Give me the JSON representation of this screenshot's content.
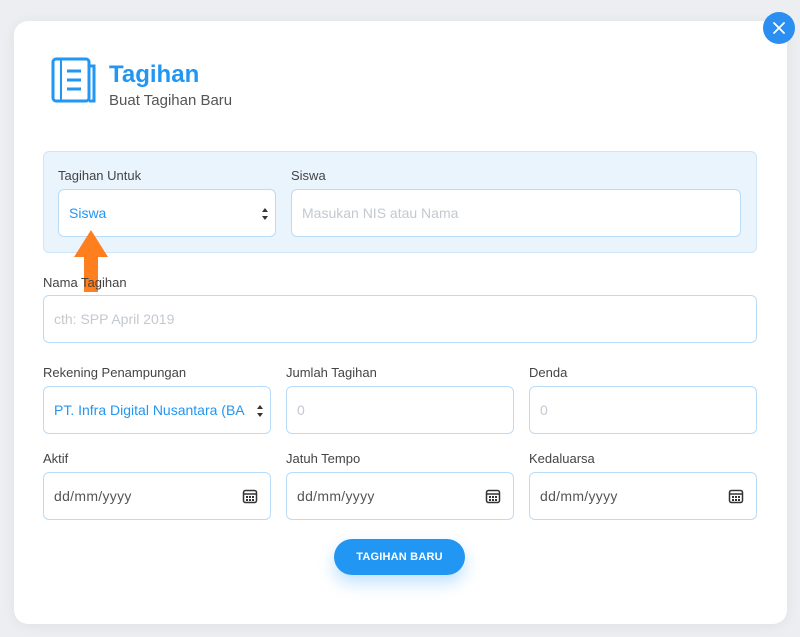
{
  "header": {
    "title": "Tagihan",
    "subtitle": "Buat Tagihan Baru",
    "icon": "document-list-icon"
  },
  "close": {
    "icon": "close-icon"
  },
  "form": {
    "tagihan_untuk": {
      "label": "Tagihan Untuk",
      "value": "Siswa"
    },
    "siswa": {
      "label": "Siswa",
      "placeholder": "Masukan NIS atau Nama"
    },
    "nama_tagihan": {
      "label": "Nama Tagihan",
      "placeholder": "cth: SPP April 2019"
    },
    "rekening": {
      "label": "Rekening Penampungan",
      "value": "PT. Infra Digital Nusantara (BA"
    },
    "jumlah": {
      "label": "Jumlah Tagihan",
      "placeholder": "0"
    },
    "denda": {
      "label": "Denda",
      "placeholder": "0"
    },
    "aktif": {
      "label": "Aktif",
      "placeholder": "dd/mm/yyyy"
    },
    "jatuh_tempo": {
      "label": "Jatuh Tempo",
      "placeholder": "dd/mm/yyyy"
    },
    "kedaluarsa": {
      "label": "Kedaluarsa",
      "placeholder": "dd/mm/yyyy"
    }
  },
  "submit": {
    "label": "TAGIHAN BARU"
  },
  "colors": {
    "accent": "#2196f3",
    "arrow": "#ff7f1f"
  }
}
